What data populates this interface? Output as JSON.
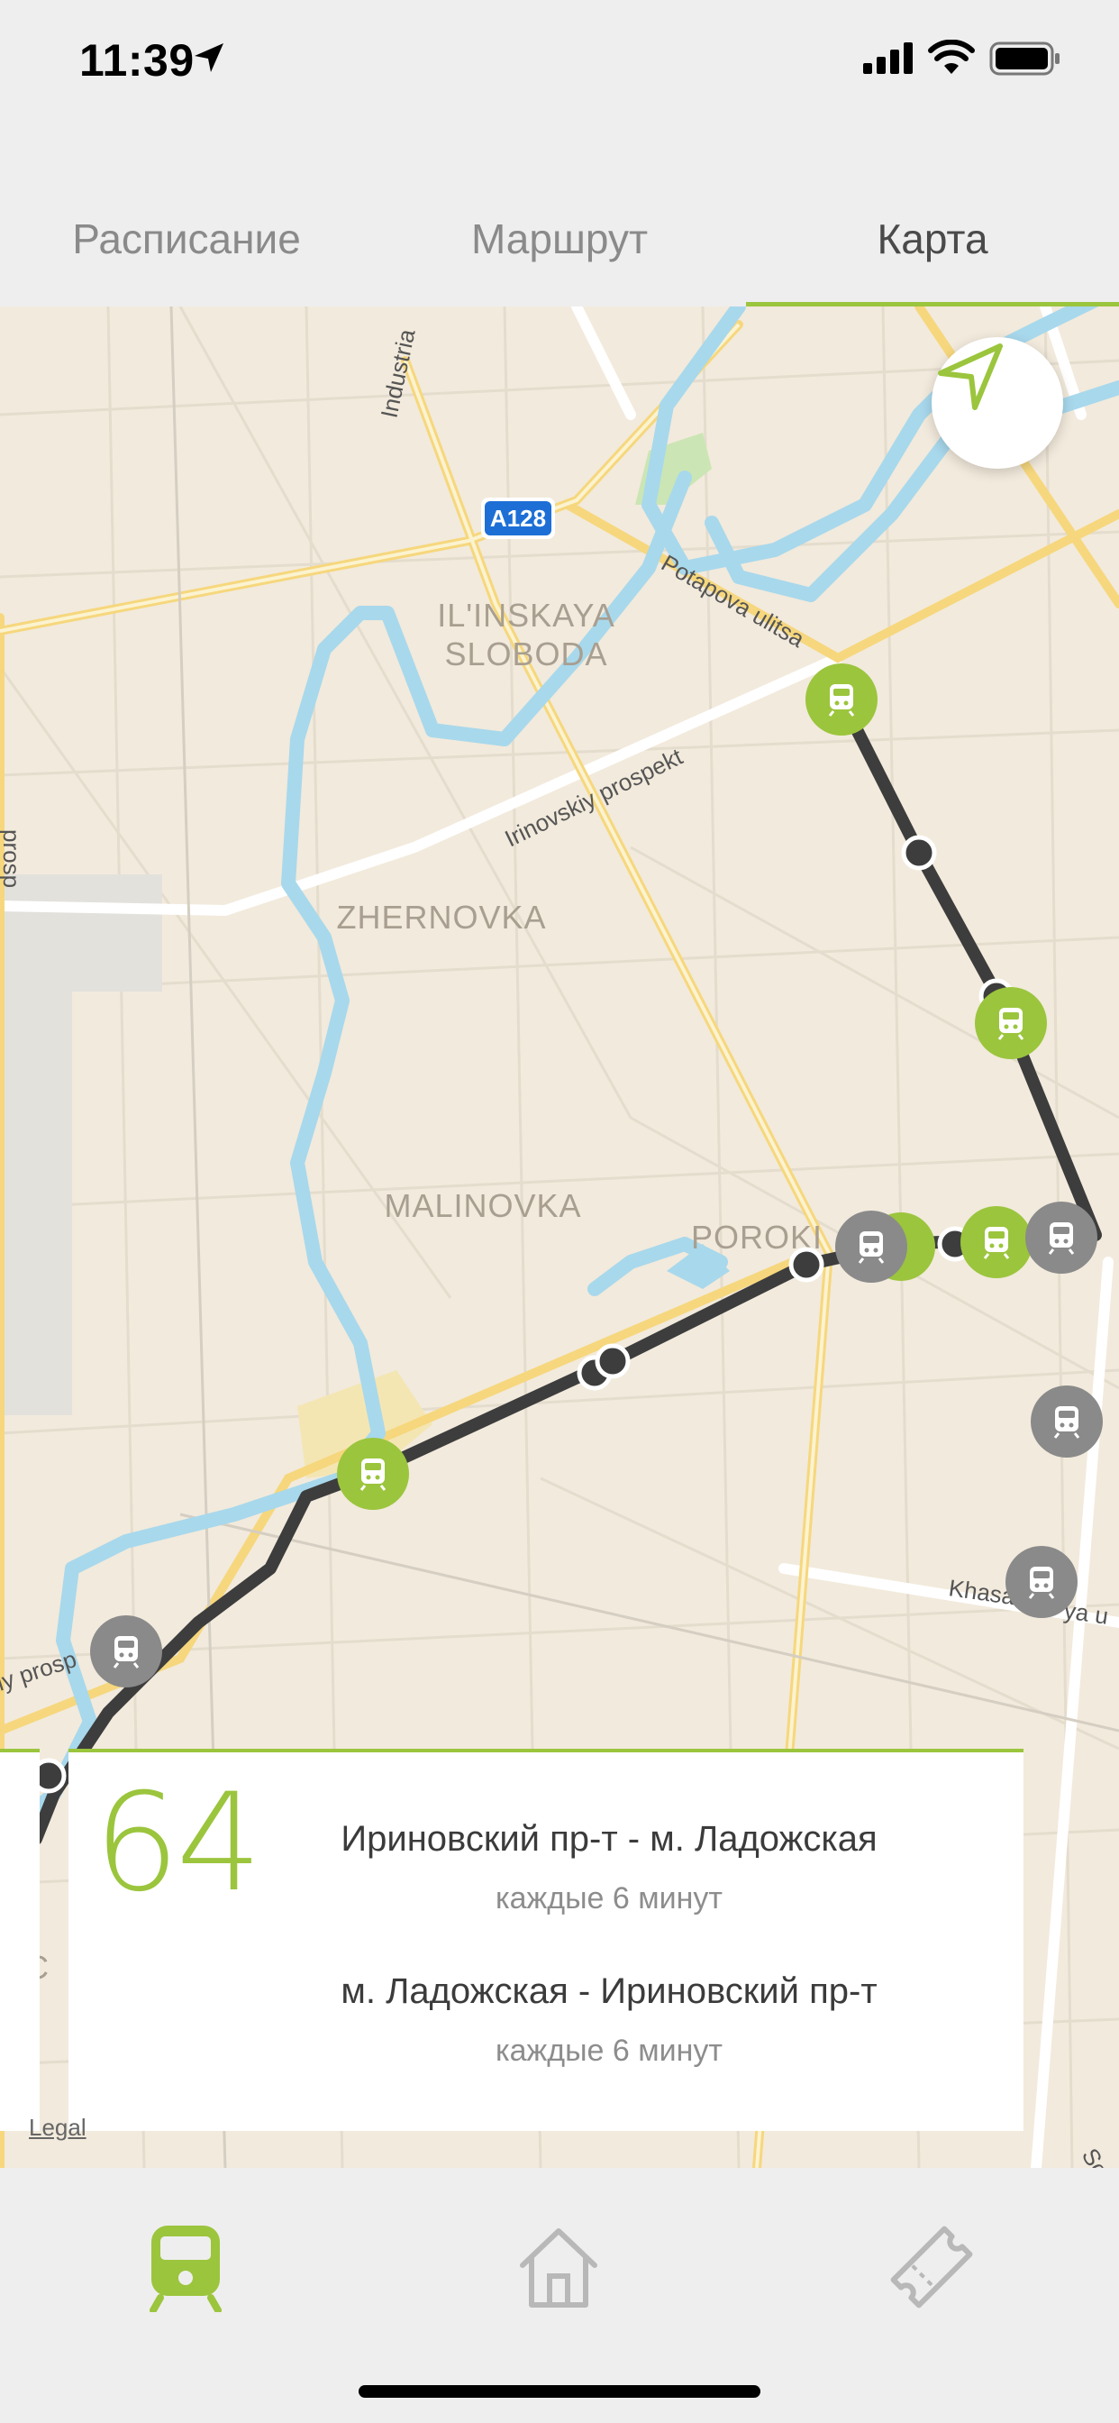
{
  "status": {
    "time": "11:39"
  },
  "tabs": [
    {
      "label": "Расписание"
    },
    {
      "label": "Маршрут"
    },
    {
      "label": "Карта"
    }
  ],
  "map": {
    "labels": {
      "ilinskaya_1": "IL'INSKAYA",
      "ilinskaya_2": "SLOBODA",
      "zhernovka": "ZHERNOVKA",
      "malinovka": "MALINOVKA",
      "poroki": "POROKI",
      "industria": "Industria",
      "potapova": "Potapova ulitsa",
      "irinovskiy": "Irinovskiy prospekt",
      "irinovskiy_cut": "iy prosp",
      "kassa": "Khasa",
      "kassa_2": "ya u",
      "highway": "A128",
      "sol": "Sol",
      "prosp_left": "prosp",
      "oc": "OC"
    },
    "colors": {
      "accent": "#9bc53d",
      "route": "#3d3d3d",
      "bus_gray": "#8a8a8a",
      "water": "#a8d8ec"
    }
  },
  "route": {
    "number": "64",
    "directions": [
      {
        "title": "Ириновский пр-т - м. Ладожская",
        "frequency": "каждые 6 минут"
      },
      {
        "title": "м. Ладожская - Ириновский пр-т",
        "frequency": "каждые 6 минут"
      }
    ]
  },
  "legal": "Legal",
  "tabbar": [
    {
      "icon": "tram-icon",
      "active": true
    },
    {
      "icon": "home-icon",
      "active": false
    },
    {
      "icon": "ticket-icon",
      "active": false
    }
  ]
}
